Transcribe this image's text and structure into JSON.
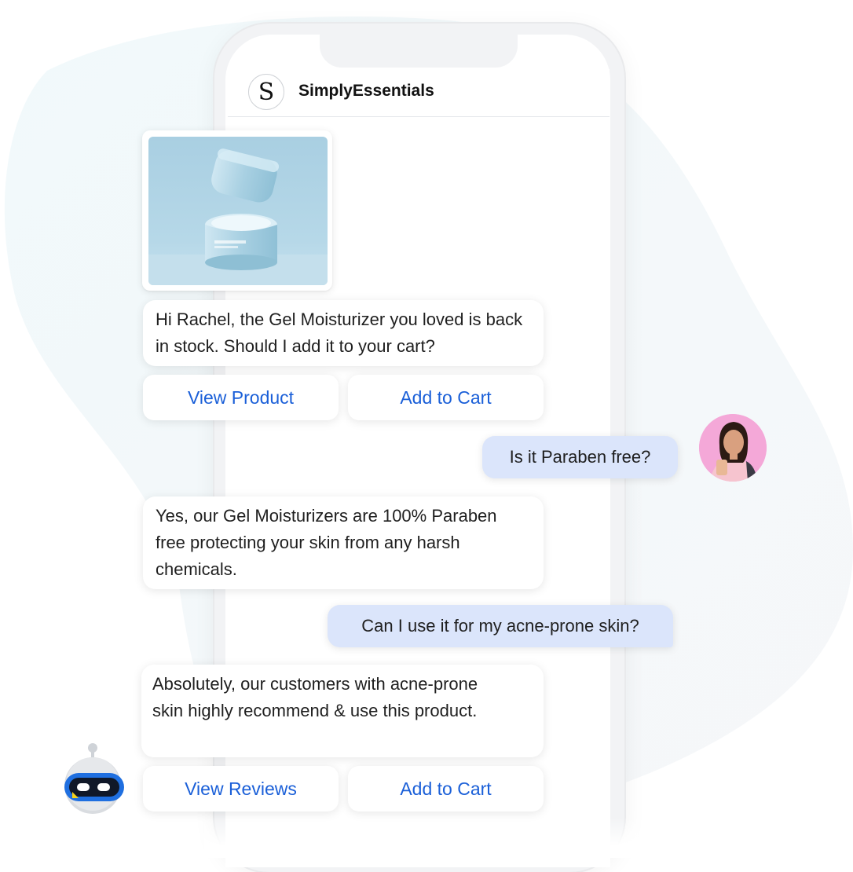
{
  "app": {
    "brand_initial": "S",
    "brand_name": "SimplyEssentials"
  },
  "messages": {
    "bot_1": "Hi Rachel, the Gel Moisturizer you loved is back in stock. Should I add it to your cart?",
    "user_1": "Is it Paraben free?",
    "bot_2": "Yes, our Gel Moisturizers are 100% Paraben free protecting your skin from any harsh chemicals.",
    "user_2": "Can I use it for my acne-prone skin?",
    "bot_3": "Absolutely, our customers with acne-prone skin highly recommend & use this product."
  },
  "actions": {
    "view_product": "View Product",
    "add_to_cart_1": "Add to Cart",
    "view_reviews": "View Reviews",
    "add_to_cart_2": "Add to Cart"
  },
  "colors": {
    "button_text": "#1a5fd8",
    "user_bubble": "#dbe5fb",
    "background_blob": "#eef7fa",
    "bot_avatar_blue": "#1f6fe0"
  },
  "icons": {
    "product_image": "gel-moisturizer-jar-image",
    "user_avatar": "user-avatar-rachel",
    "bot_avatar": "chatbot-robot-icon"
  }
}
